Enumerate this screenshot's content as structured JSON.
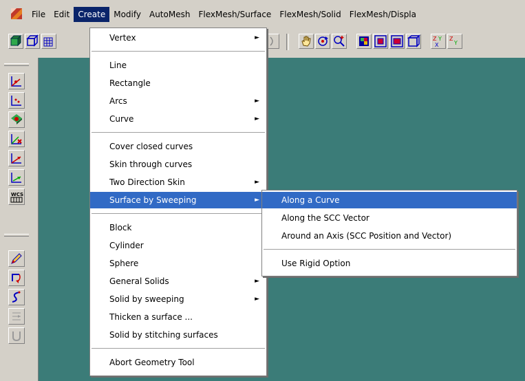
{
  "menubar": {
    "items": [
      "File",
      "Edit",
      "Create",
      "Modify",
      "AutoMesh",
      "FlexMesh/Surface",
      "FlexMesh/Solid",
      "FlexMesh/Displa"
    ],
    "active_index": 2
  },
  "create_menu": {
    "items": [
      {
        "label": "Vertex",
        "submenu": true
      },
      {
        "label": "Line",
        "submenu": false
      },
      {
        "label": "Rectangle",
        "submenu": false
      },
      {
        "label": "Arcs",
        "submenu": true
      },
      {
        "label": "Curve",
        "submenu": true
      },
      {
        "label": "Cover closed curves",
        "submenu": false
      },
      {
        "label": "Skin through curves",
        "submenu": false
      },
      {
        "label": "Two Direction Skin",
        "submenu": true
      },
      {
        "label": "Surface by Sweeping",
        "submenu": true
      },
      {
        "label": "Block",
        "submenu": false
      },
      {
        "label": "Cylinder",
        "submenu": false
      },
      {
        "label": "Sphere",
        "submenu": false
      },
      {
        "label": "General Solids",
        "submenu": true
      },
      {
        "label": "Solid by sweeping",
        "submenu": true
      },
      {
        "label": "Thicken a surface ...",
        "submenu": false
      },
      {
        "label": "Solid by stitching surfaces",
        "submenu": false
      },
      {
        "label": "Abort Geometry Tool",
        "submenu": false
      }
    ],
    "highlighted_index": 8,
    "arrow_glyph": "►"
  },
  "sweep_submenu": {
    "items": [
      {
        "label": "Along a Curve"
      },
      {
        "label": "Along the SCC Vector"
      },
      {
        "label": "Around an Axis (SCC Position and Vector)"
      },
      {
        "label": "Use Rigid Option"
      }
    ],
    "highlighted_index": 0
  },
  "colors": {
    "workspace": "#3b7c78",
    "menu_highlight": "#316ac5",
    "menubar_highlight": "#0a246a",
    "chrome": "#d4d0c8"
  },
  "icons": {
    "top_toolbar": [
      "view-iso-icon",
      "view-iso2-icon",
      "mesh-view-icon",
      "pan-hand-icon",
      "rotate-icon",
      "zoom-icon",
      "render-icon",
      "view-front-icon",
      "view-side-icon",
      "view-top-icon",
      "axis-xy-icon",
      "axis-zy-icon"
    ],
    "left_toolbar": [
      "vertex-create-icon",
      "vertex-points-icon",
      "vertex-project-icon",
      "vertex-delete-icon",
      "vector-icon",
      "vector-offset-icon",
      "wcs-icon",
      "pencil-icon",
      "rotate-curve-icon",
      "s-curve-icon",
      "grid-snap-icon",
      "u-curve-icon"
    ]
  }
}
